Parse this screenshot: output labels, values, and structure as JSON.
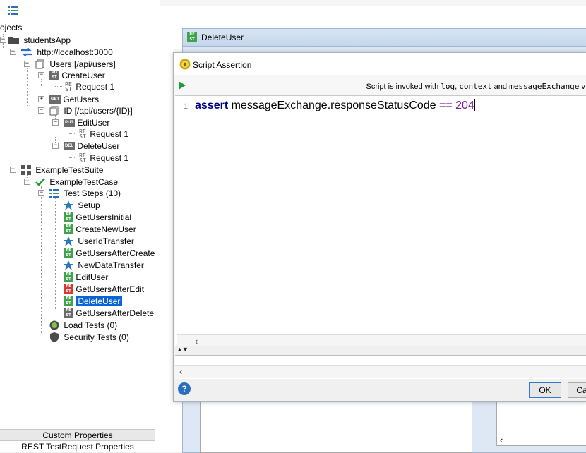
{
  "navigator": {
    "root_label": "ojects",
    "app": "studentsApp",
    "service": "http://localhost:3000",
    "resource_users": "Users [/api/users]",
    "create_user": "CreateUser",
    "get_users": "GetUsers",
    "resource_id": "ID [/api/users/{ID}]",
    "edit_user": "EditUser",
    "delete_user": "DeleteUser",
    "request_1": "Request 1",
    "test_suite": "ExampleTestSuite",
    "test_case": "ExampleTestCase",
    "test_steps": "Test Steps (10)",
    "steps": [
      "Setup",
      "GetUsersInitial",
      "CreateNewUser",
      "UserIdTransfer",
      "GetUsersAfterCreate",
      "NewDataTransfer",
      "EditUser",
      "GetUsersAfterEdit",
      "DeleteUser",
      "GetUsersAfterDelete"
    ],
    "load_tests": "Load Tests (0)",
    "security_tests": "Security Tests (0)",
    "method_post": "POST",
    "method_get": "GET",
    "method_put": "PUT",
    "method_del": "DEL",
    "rest_abbr": "RE ST"
  },
  "bottom_tabs": {
    "custom": "Custom Properties",
    "rest": "REST TestRequest Properties"
  },
  "delete_window": {
    "title": "DeleteUser"
  },
  "dialog": {
    "title": "Script Assertion",
    "hint_prefix": "Script is invoked with ",
    "hint_log": "log",
    "hint_sep1": ", ",
    "hint_context": "context",
    "hint_and": " and ",
    "hint_me": "messageExchange",
    "hint_suffix": " v",
    "line_number": "1",
    "code_keyword": "assert",
    "code_expr": " messageExchange.responseStatusCode ",
    "code_op": "==",
    "code_num": " 204",
    "ok_label": "OK",
    "cancel_label": "Ca",
    "help_label": "?"
  },
  "colors": {
    "selection": "#0a64d6",
    "keyword": "#00008b",
    "literal": "#7a1fa2",
    "rest_green": "#3fa34d",
    "rest_red": "#d73a2e"
  }
}
